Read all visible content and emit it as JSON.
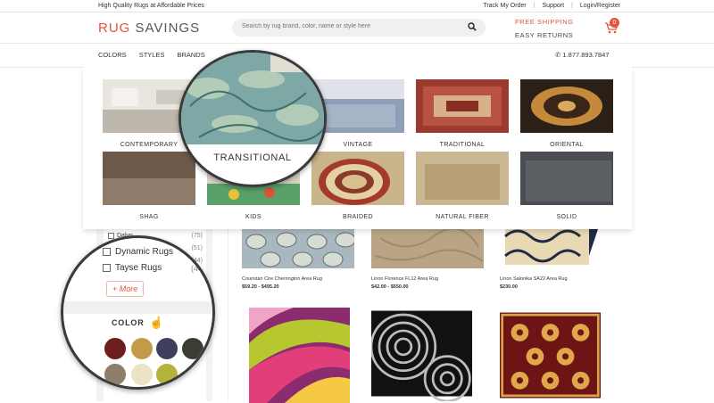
{
  "topbar": {
    "tagline": "High Quality Rugs at Affordable Prices",
    "links": [
      "Track My Order",
      "Support",
      "Login/Register"
    ]
  },
  "header": {
    "logo_part1": "RUG",
    "logo_part2": "SAVINGS",
    "search_placeholder": "Search by rug brand, color, name or style here",
    "free_shipping": "FREE SHIPPING",
    "easy_returns": "EASY RETURNS",
    "cart_count": "0"
  },
  "nav": {
    "items": [
      "COLORS",
      "STYLES",
      "BRANDS"
    ],
    "phone": "1.877.893.7847"
  },
  "styles_menu": {
    "magnified_label": "TRANSITIONAL",
    "tiles": [
      {
        "label": "CONTEMPORARY"
      },
      {
        "label": "TRANSITIONAL"
      },
      {
        "label": "VINTAGE"
      },
      {
        "label": "TRADITIONAL"
      },
      {
        "label": "ORIENTAL"
      },
      {
        "label": "SHAG"
      },
      {
        "label": "KIDS"
      },
      {
        "label": "BRAIDED"
      },
      {
        "label": "NATURAL FIBER"
      },
      {
        "label": "SOLID"
      }
    ]
  },
  "brand_filter": {
    "items": [
      {
        "name": "Dalyn",
        "count": "(75)"
      },
      {
        "name": "Dynamic Rugs",
        "count": "(51)"
      },
      {
        "name": "Tayse Rugs",
        "count": "(44)"
      }
    ],
    "more_label": "+ More"
  },
  "color_filter": {
    "title": "COLOR",
    "swatches": [
      "#6b1f1f",
      "#c29a4a",
      "#3e3f5e",
      "#3a3d33",
      "#8e7e6c",
      "#ece2c6",
      "#b4b33a"
    ]
  },
  "products": [
    {
      "name": "Couristan Cire Cherrington Area Rug",
      "price": "$59.20 - $495.20"
    },
    {
      "name": "Linon Florence FL12 Area Rug",
      "price": "$42.00 - $550.00"
    },
    {
      "name": "Linon Salonika SA22 Area Rug",
      "price": "$230.00"
    }
  ]
}
